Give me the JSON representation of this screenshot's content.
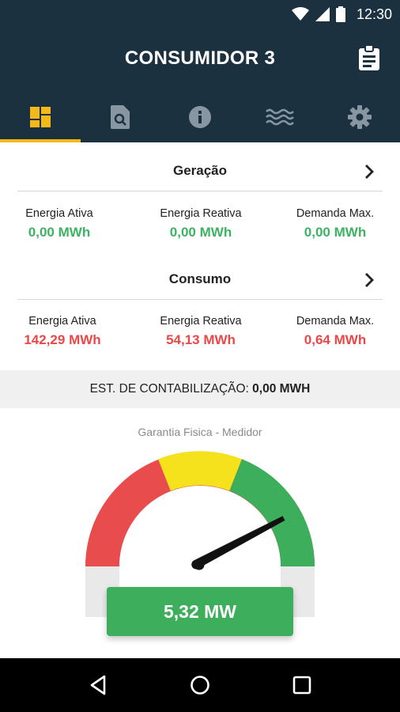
{
  "status_bar": {
    "time": "12:30",
    "icons": [
      "wifi-icon",
      "signal-icon",
      "battery-icon"
    ]
  },
  "header": {
    "title": "CONSUMIDOR 3",
    "action_icon": "clipboard-icon"
  },
  "tabs": [
    {
      "icon": "dashboard-icon",
      "active": true
    },
    {
      "icon": "document-search-icon",
      "active": false
    },
    {
      "icon": "info-icon",
      "active": false
    },
    {
      "icon": "waves-icon",
      "active": false
    },
    {
      "icon": "gear-icon",
      "active": false
    }
  ],
  "geracao": {
    "title": "Geração",
    "metrics": [
      {
        "label": "Energia Ativa",
        "value": "0,00 MWh"
      },
      {
        "label": "Energia Reativa",
        "value": "0,00 MWh"
      },
      {
        "label": "Demanda Max.",
        "value": "0,00 MWh"
      }
    ]
  },
  "consumo": {
    "title": "Consumo",
    "metrics": [
      {
        "label": "Energia Ativa",
        "value": "142,29 MWh"
      },
      {
        "label": "Energia Reativa",
        "value": "54,13 MWh"
      },
      {
        "label": "Demanda Max.",
        "value": "0,64 MWh"
      }
    ]
  },
  "summary": {
    "label": "EST. DE CONTABILIZAÇÃO:",
    "value": "0,00 MWH"
  },
  "gauge": {
    "title": "Garantia Fisica - Medidor",
    "value": "5,32 MW",
    "needle_fraction": 0.82,
    "colors": {
      "red": "#e84c4c",
      "yellow": "#f6e21c",
      "green": "#3daf5c"
    }
  },
  "colors": {
    "appbar": "#1b3140",
    "tab_accent": "#f5b81a",
    "positive": "#3db262",
    "negative": "#ea4848"
  },
  "nav_bar": [
    "back-icon",
    "home-icon",
    "recents-icon"
  ]
}
